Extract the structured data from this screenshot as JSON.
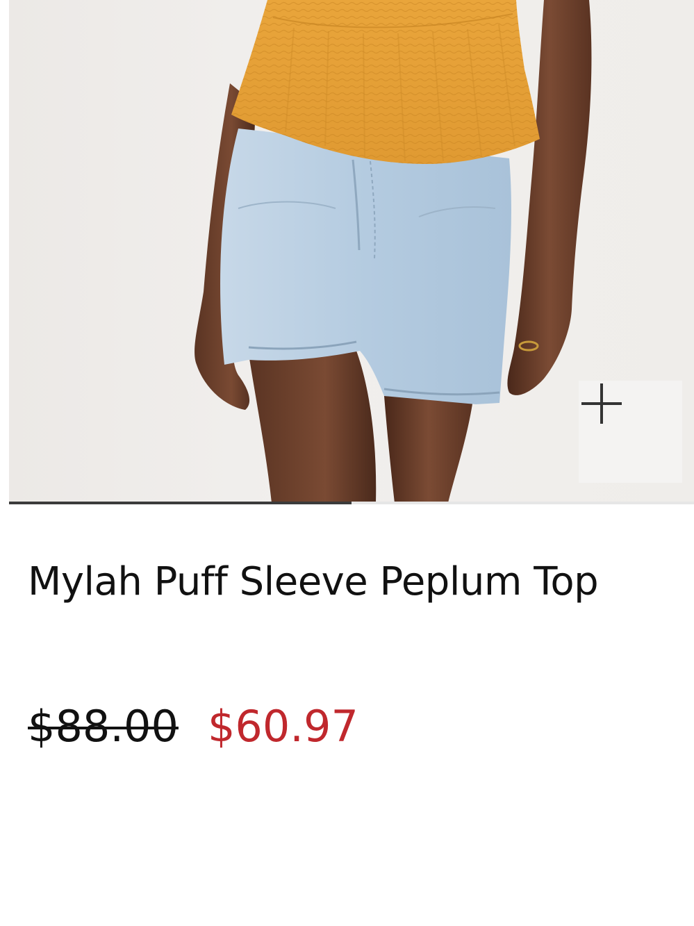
{
  "product": {
    "title": "Mylah Puff Sleeve Peplum Top",
    "image_alt": "Model wearing orange puff sleeve peplum top with light-wash denim shorts",
    "price_original": "$88.00",
    "price_sale": "$60.97"
  },
  "gallery": {
    "zoom_icon": "plus-icon",
    "progress": 0.5
  },
  "colors": {
    "top": "#e8a43a",
    "denim": "#b9cfe3",
    "sale_price": "#c0282d",
    "text": "#111111",
    "progress_bar": "#3b3b3b"
  }
}
